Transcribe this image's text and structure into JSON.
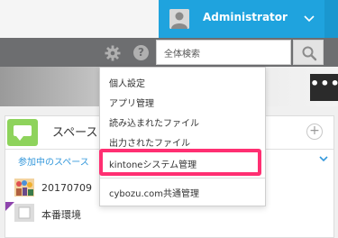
{
  "header": {
    "user_name": "Administrator",
    "accent_color": "#1fa3de"
  },
  "toolbar": {
    "search_placeholder": "全体検索",
    "icons": [
      "gear-icon",
      "help-icon",
      "search-icon"
    ]
  },
  "banner": {
    "more_label": "•••"
  },
  "spaces": {
    "title": "スペース",
    "add_label": "+",
    "filter_label": "参加中のスペース",
    "items": [
      {
        "label": "20170709"
      },
      {
        "label": "本番環境"
      }
    ]
  },
  "user_menu": {
    "items": [
      {
        "label": "個人設定"
      },
      {
        "label": "アプリ管理"
      },
      {
        "label": "読み込まれたファイル"
      },
      {
        "label": "出力されたファイル"
      },
      {
        "label": "kintoneシステム管理",
        "highlighted": true
      },
      {
        "label": "cybozu.com共通管理"
      }
    ],
    "highlight_color": "#ff2f72"
  }
}
